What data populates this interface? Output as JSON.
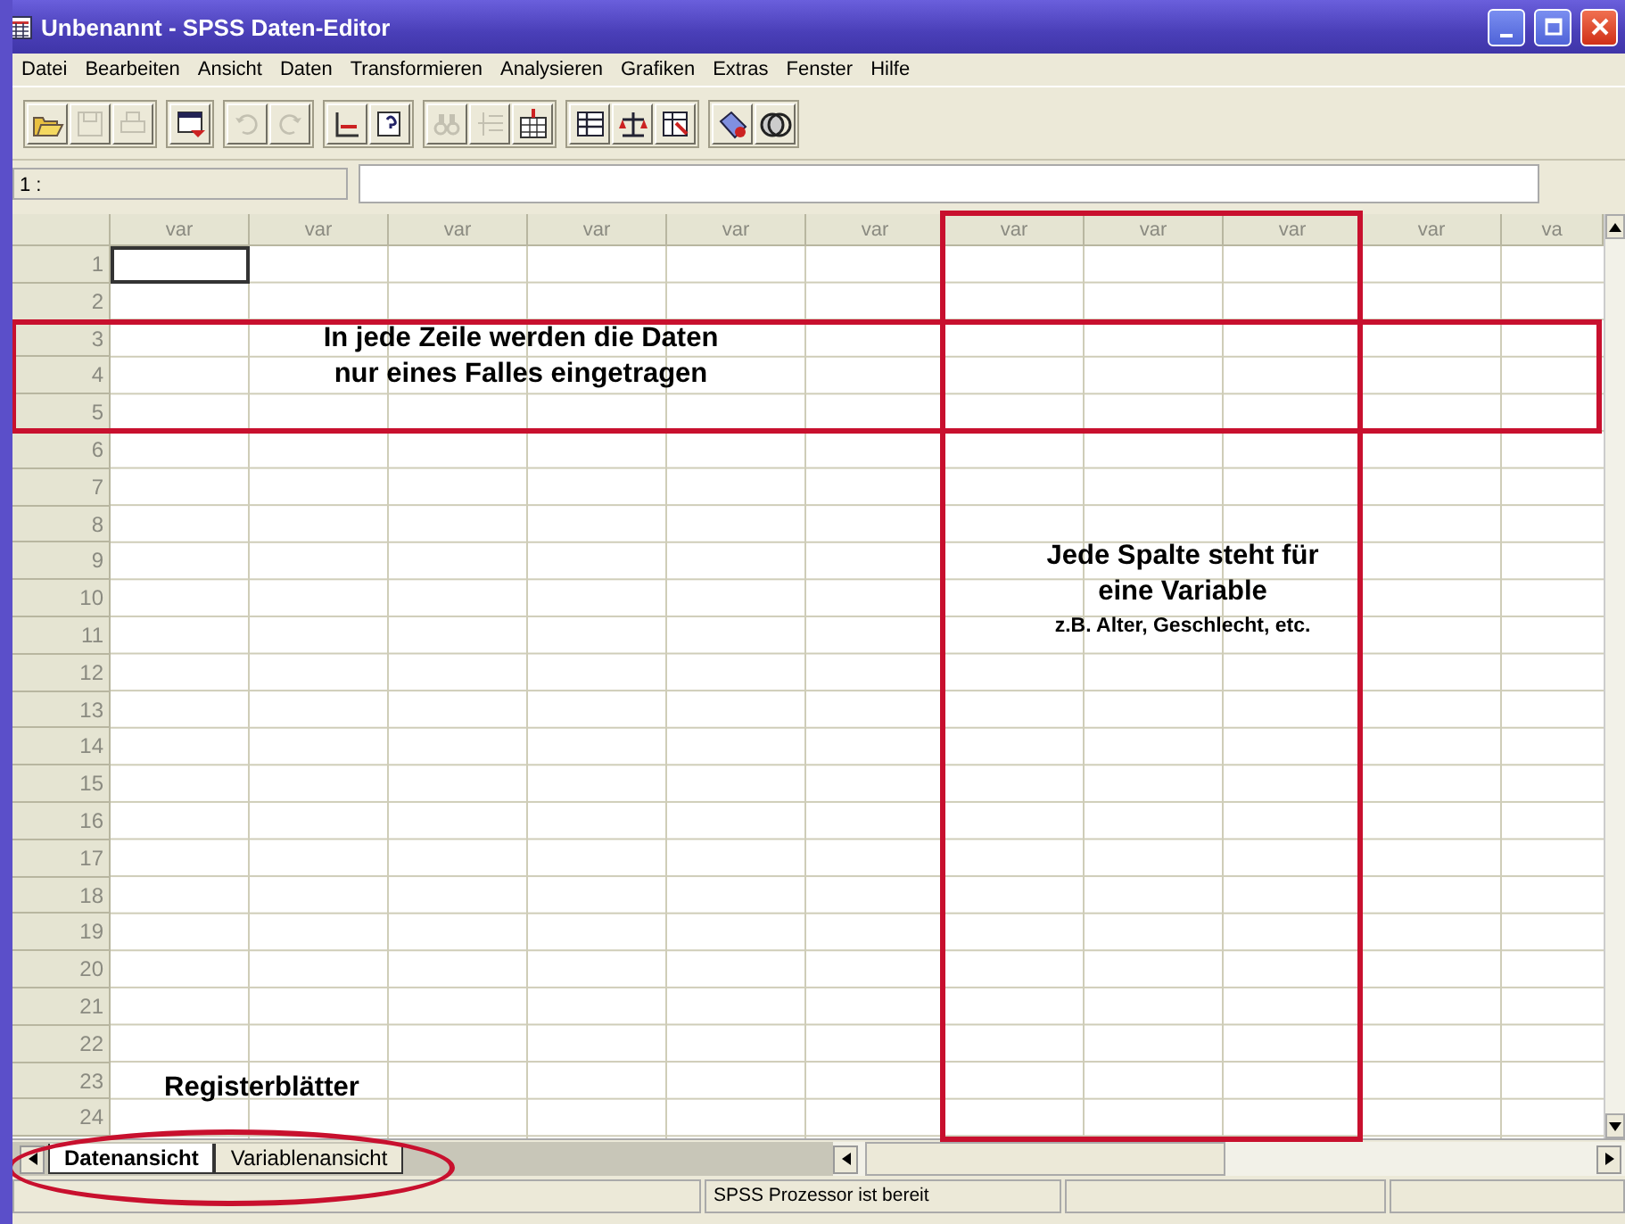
{
  "window": {
    "title": "Unbenannt - SPSS Daten-Editor"
  },
  "menu": [
    "Datei",
    "Bearbeiten",
    "Ansicht",
    "Daten",
    "Transformieren",
    "Analysieren",
    "Grafiken",
    "Extras",
    "Fenster",
    "Hilfe"
  ],
  "toolbar": [
    [
      {
        "kind": "open",
        "disabled": false
      },
      {
        "kind": "save",
        "disabled": true
      },
      {
        "kind": "print",
        "disabled": true
      }
    ],
    [
      {
        "kind": "dialog",
        "disabled": false
      }
    ],
    [
      {
        "kind": "undo",
        "disabled": true
      },
      {
        "kind": "redo",
        "disabled": true
      }
    ],
    [
      {
        "kind": "goto",
        "disabled": false
      },
      {
        "kind": "variables",
        "disabled": false
      }
    ],
    [
      {
        "kind": "find",
        "disabled": true
      },
      {
        "kind": "insert-case",
        "disabled": true
      },
      {
        "kind": "insert-variable",
        "disabled": false
      }
    ],
    [
      {
        "kind": "split",
        "disabled": false
      },
      {
        "kind": "weight",
        "disabled": false
      },
      {
        "kind": "select",
        "disabled": false
      }
    ],
    [
      {
        "kind": "labels",
        "disabled": false
      },
      {
        "kind": "sets",
        "disabled": false
      }
    ]
  ],
  "cell_editor": {
    "reference": "1 :"
  },
  "grid": {
    "columns": [
      {
        "label": "var",
        "highlighted": false
      },
      {
        "label": "var",
        "highlighted": false
      },
      {
        "label": "var",
        "highlighted": false
      },
      {
        "label": "var",
        "highlighted": false
      },
      {
        "label": "var",
        "highlighted": false
      },
      {
        "label": "var",
        "highlighted": false
      },
      {
        "label": "var",
        "highlighted": true
      },
      {
        "label": "var",
        "highlighted": true
      },
      {
        "label": "var",
        "highlighted": true
      },
      {
        "label": "var",
        "highlighted": false
      },
      {
        "label": "va",
        "highlighted": false
      }
    ],
    "rows": [
      {
        "label": "1",
        "highlighted": false,
        "focused": true
      },
      {
        "label": "2",
        "highlighted": false,
        "focused": false
      },
      {
        "label": "3",
        "highlighted": true,
        "focused": false
      },
      {
        "label": "4",
        "highlighted": true,
        "focused": false
      },
      {
        "label": "5",
        "highlighted": true,
        "focused": false
      },
      {
        "label": "6",
        "highlighted": false,
        "focused": false
      },
      {
        "label": "7",
        "highlighted": false,
        "focused": false
      },
      {
        "label": "8",
        "highlighted": false,
        "focused": false
      },
      {
        "label": "9",
        "highlighted": false,
        "focused": false
      },
      {
        "label": "10",
        "highlighted": false,
        "focused": false
      },
      {
        "label": "11",
        "highlighted": false,
        "focused": false
      },
      {
        "label": "12",
        "highlighted": false,
        "focused": false
      },
      {
        "label": "13",
        "highlighted": false,
        "focused": false
      },
      {
        "label": "14",
        "highlighted": false,
        "focused": false
      },
      {
        "label": "15",
        "highlighted": false,
        "focused": false
      },
      {
        "label": "16",
        "highlighted": false,
        "focused": false
      },
      {
        "label": "17",
        "highlighted": false,
        "focused": false
      },
      {
        "label": "18",
        "highlighted": false,
        "focused": false
      },
      {
        "label": "19",
        "highlighted": false,
        "focused": false
      },
      {
        "label": "20",
        "highlighted": false,
        "focused": false
      },
      {
        "label": "21",
        "highlighted": false,
        "focused": false
      },
      {
        "label": "22",
        "highlighted": false,
        "focused": false
      },
      {
        "label": "23",
        "highlighted": false,
        "focused": false
      },
      {
        "label": "24",
        "highlighted": false,
        "focused": false
      }
    ]
  },
  "notes": [
    {
      "kind": "rows",
      "lines": [
        "In jede Zeile werden die Daten",
        "nur eines Falles eingetragen"
      ]
    },
    {
      "kind": "columns",
      "lines": [
        "Jede Spalte steht für",
        "eine Variable"
      ],
      "detail": "z.B. Alter, Geschlecht, etc."
    },
    {
      "kind": "tabs",
      "lines": [
        "Registerblätter"
      ]
    }
  ],
  "tabs": {
    "circled": true,
    "items": [
      {
        "label": "Datenansicht",
        "selected": true
      },
      {
        "label": "Variablenansicht",
        "selected": false
      }
    ]
  },
  "status_bar": {
    "message": "SPSS Prozessor  ist bereit"
  }
}
